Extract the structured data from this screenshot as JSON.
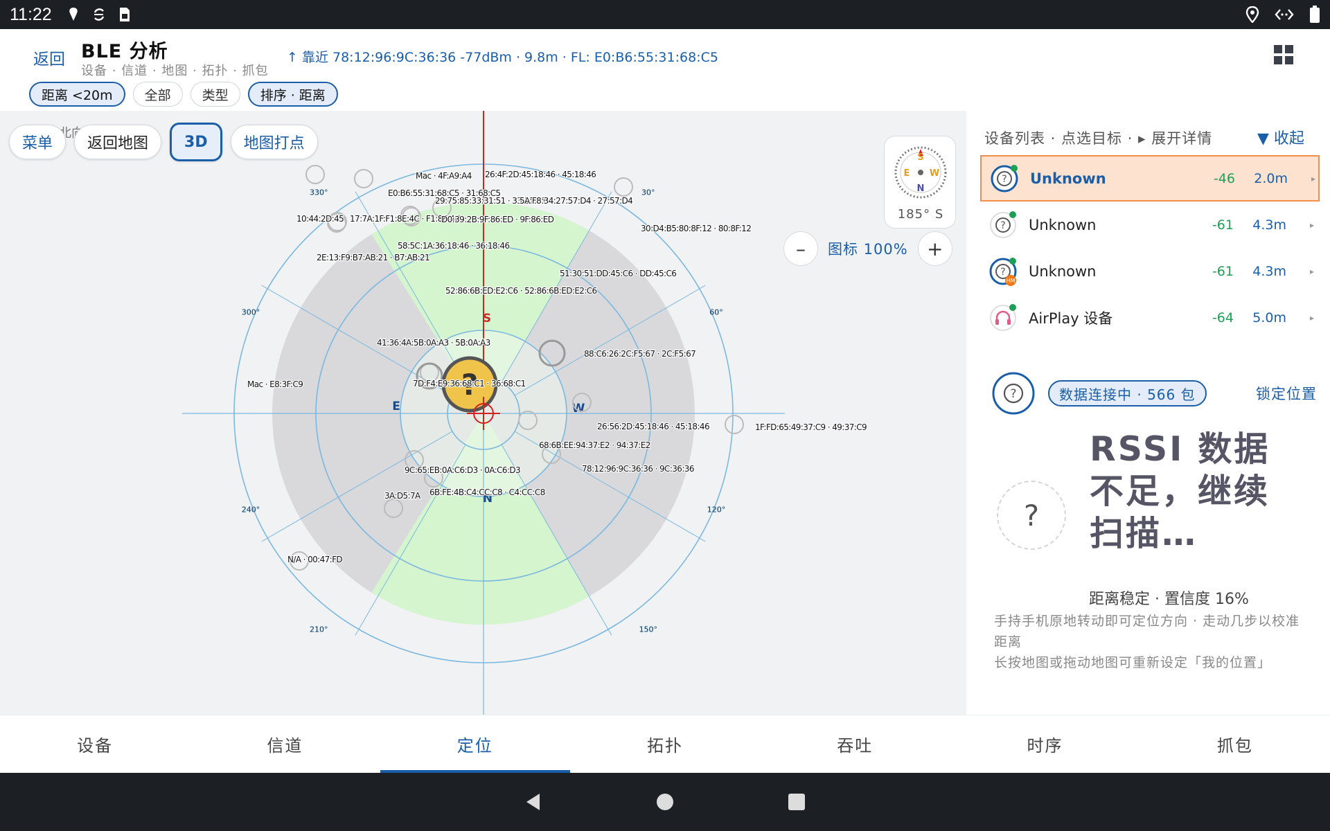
{
  "status_bar": {
    "time": "11:22",
    "left_icons": [
      "location-pin-icon",
      "sync-icon",
      "sim-card-icon"
    ],
    "right_icons": [
      "location-icon",
      "code-icon",
      "battery-icon"
    ]
  },
  "header": {
    "back_label": "返回",
    "title": "BLE 分析",
    "subtitle": "设备 · 信道 · 地图 · 拓扑 · 抓包",
    "near_info": "↑ 靠近 78:12:96:9C:36:36 -77dBm · 9.8m  ·  FL: E0:B6:55:31:68:C5",
    "chips": [
      {
        "label": "距离 <20m",
        "active": true
      },
      {
        "label": "全部",
        "active": false
      },
      {
        "label": "类型",
        "active": false
      },
      {
        "label": "排序 · 距离",
        "active": true
      }
    ]
  },
  "map": {
    "buttons": {
      "menu": "菜单",
      "back_to_map": "返回地图",
      "three_d": "3D",
      "map_pin": "地图打点"
    },
    "hint_text": "北向/扫描",
    "hint_text_suffix": "D",
    "compass_label": "185° S",
    "compass_letters": [
      "S",
      "W",
      "N",
      "E"
    ],
    "zoom_label": "图标 100%",
    "zoom_minus": "–",
    "zoom_plus": "+",
    "directions": [
      "S",
      "W",
      "N",
      "E"
    ],
    "angle_labels": [
      "330°",
      "30°",
      "300°",
      "60°",
      "240°",
      "120°",
      "210°",
      "150°"
    ],
    "device_labels": [
      "Mac · 4F:A9:A4",
      "26:4F:2D:45:18:46 · 45:18:46",
      "E0:B6:55:31:68:C5 · 31:68:C5",
      "29:75:85:33:31:51 · 33:31:51",
      "5A:F8:34:27:57:D4 · 27:57:D4",
      "10:44:2D:45",
      "17:7A:1F:F1:8E:4C · F1:8E:4C",
      "D0:39:2B:9F:86:ED · 9F:86:ED",
      "30:D4:B5:80:8F:12 · 80:8F:12",
      "58:5C:1A:36:18:46 · 36:18:46",
      "2E:13:F9:B7:AB:21 · B7:AB:21",
      "51:30:51:DD:45:C6 · DD:45:C6",
      "52:86:6B:ED:E2:C6 · 52:86:6B:ED:E2:C6",
      "41:36:4A:5B:0A:A3 · 5B:0A:A3",
      "88:C6:26:2C:F5:67 · 2C:F5:67",
      "Mac · E8:3F:C9",
      "7D:F4:E9:36:68:C1 · 36:68:C1",
      "26:56:2D:45:18:46 · 45:18:46",
      "1F:FD:65:49:37:C9 · 49:37:C9",
      "68:6B:EE:94:37:E2 · 94:37:E2",
      "9C:65:EB:0A:C6:D3 · 0A:C6:D3",
      "78:12:96:9C:36:36 · 9C:36:36",
      "3A:D5:7A",
      "6B:FE:4B:C4:CC:C8 · C4:CC:C8",
      "N/A · 00:47:FD"
    ],
    "colors": {
      "ring": "#7ab8e0",
      "sector_green": "#d5f5cf",
      "sector_gray": "#d9d9dc",
      "heading": "#d62020"
    }
  },
  "panel": {
    "header": "设备列表 · 点选目标 · ▸ 展开详情",
    "collapse": "▼ 收起",
    "devices": [
      {
        "name": "Unknown",
        "rssi": "-46",
        "dist": "2.0m",
        "arrow": "▸",
        "selected": true,
        "icon": "unknown-device-icon"
      },
      {
        "name": "Unknown",
        "rssi": "-61",
        "dist": "4.3m",
        "arrow": "▸",
        "selected": false,
        "icon": "unknown-device-icon"
      },
      {
        "name": "Unknown",
        "rssi": "-61",
        "dist": "4.3m",
        "arrow": "▸",
        "selected": false,
        "icon": "unknown-device-icon",
        "badge": "HM"
      },
      {
        "name": "AirPlay 设备",
        "rssi": "-64",
        "dist": "5.0m",
        "arrow": "▸",
        "selected": false,
        "icon": "headphones-icon"
      }
    ],
    "connection_badge": "数据连接中 · 566 包",
    "lock_position": "锁定位置",
    "big_message": "RSSI 数据不足，继续扫描…",
    "confidence": "距离稳定 · 置信度 16%",
    "tip1": "手持手机原地转动即可定位方向 · 走动几步以校准距离",
    "tip2": "长按地图或拖动地图可重新设定「我的位置」"
  },
  "tabs": [
    {
      "label": "设备",
      "active": false
    },
    {
      "label": "信道",
      "active": false
    },
    {
      "label": "定位",
      "active": true
    },
    {
      "label": "拓扑",
      "active": false
    },
    {
      "label": "吞吐",
      "active": false
    },
    {
      "label": "时序",
      "active": false
    },
    {
      "label": "抓包",
      "active": false
    }
  ]
}
